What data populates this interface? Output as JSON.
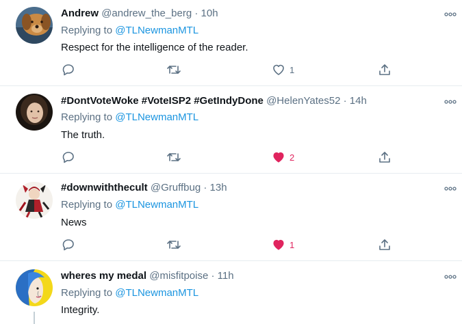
{
  "tweets": [
    {
      "name": "Andrew",
      "handle": "@andrew_the_berg",
      "dot": "·",
      "time": "10h",
      "replying_prefix": "Replying to ",
      "replying_to": "@TLNewmanMTL",
      "text": "Respect for the intelligence of the reader.",
      "like_count": "1",
      "liked": false
    },
    {
      "name": "#DontVoteWoke #VoteISP2 #GetIndyDone",
      "handle": "@HelenYates52",
      "dot": "·",
      "time": "14h",
      "replying_prefix": "Replying to ",
      "replying_to": "@TLNewmanMTL",
      "text": "The truth.",
      "like_count": "2",
      "liked": true
    },
    {
      "name": "#downwiththecult",
      "handle": "@Gruffbug",
      "dot": "·",
      "time": "13h",
      "replying_prefix": "Replying to ",
      "replying_to": "@TLNewmanMTL",
      "text": "News",
      "like_count": "1",
      "liked": true
    },
    {
      "name": "wheres my medal",
      "handle": "@misfitpoise",
      "dot": "·",
      "time": "11h",
      "replying_prefix": "Replying to ",
      "replying_to": "@TLNewmanMTL",
      "text": "Integrity."
    }
  ],
  "colors": {
    "accent": "#1b95e0",
    "secondary_text": "#5b7083",
    "like_active": "#e0245e",
    "divider": "#e6ecf0"
  },
  "icons": [
    "reply-icon",
    "retweet-icon",
    "like-icon",
    "share-icon",
    "more-options-icon"
  ]
}
